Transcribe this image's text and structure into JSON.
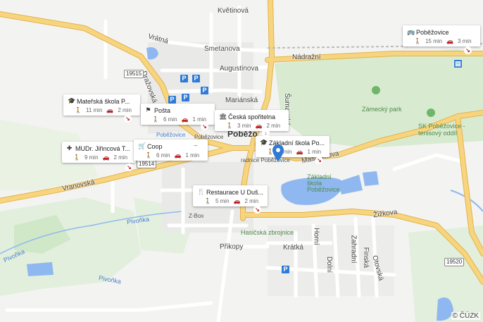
{
  "map": {
    "streets": [
      "Květinová",
      "Vrátná",
      "Smetanova",
      "Nádražní",
      "Augustinova",
      "Mariánská",
      "Vranovská",
      "Pivoňka",
      "Pivoňka",
      "Pivoňka",
      "Žižkova",
      "Přikopy",
      "Krátká",
      "Horní",
      "Dolní",
      "Zahradní",
      "Finská",
      "Otovská",
      "Masarykova",
      "Šumavská",
      "Dražovská",
      "Pobězovice"
    ],
    "places": [
      "Zámecký park",
      "SK Poběžovice - tenisový oddíl",
      "Základní škola Poběžovice",
      "Hasičská zbrojnice",
      "Z-Box",
      "radnice Poběžovice",
      "Poběžovice"
    ],
    "town_label": "Poběžo",
    "road_numbers": [
      "19515",
      "19514",
      "19520"
    ],
    "copyright": "© ČÚZK"
  },
  "cards": [
    {
      "icon": "bus-icon",
      "glyph": "🚌",
      "title": "Poběžovice",
      "walk": "15 min",
      "drive": "3 min"
    },
    {
      "icon": "school-icon",
      "glyph": "🎓",
      "title": "Mateřská škola P...",
      "walk": "11 min",
      "drive": "2 min"
    },
    {
      "icon": "post-icon",
      "glyph": "⚑",
      "title": "Pošta",
      "walk": "6 min",
      "drive": "1 min"
    },
    {
      "icon": "bank-icon",
      "glyph": "🏛",
      "title": "Česká spořitelna",
      "walk": "3 min",
      "drive": "2 min"
    },
    {
      "icon": "school-icon",
      "glyph": "🎓",
      "title": "Základní škola Po...",
      "walk": "3 min",
      "drive": "1 min"
    },
    {
      "icon": "medical-icon",
      "glyph": "✚",
      "title": "MUDr. Jiřincová T...",
      "walk": "9 min",
      "drive": "2 min"
    },
    {
      "icon": "cart-icon",
      "glyph": "🛒",
      "title": "Coop",
      "walk": "6 min",
      "drive": "1 min"
    },
    {
      "icon": "restaurant-icon",
      "glyph": "🍴",
      "title": "Restaurace U Duš...",
      "walk": "5 min",
      "drive": "2 min"
    }
  ],
  "colors": {
    "road_major": "#f7d57f",
    "road_outline": "#e3b24c",
    "water": "#8fb8f0",
    "park": "#d7ead0",
    "pin": "#2f7ad6"
  }
}
